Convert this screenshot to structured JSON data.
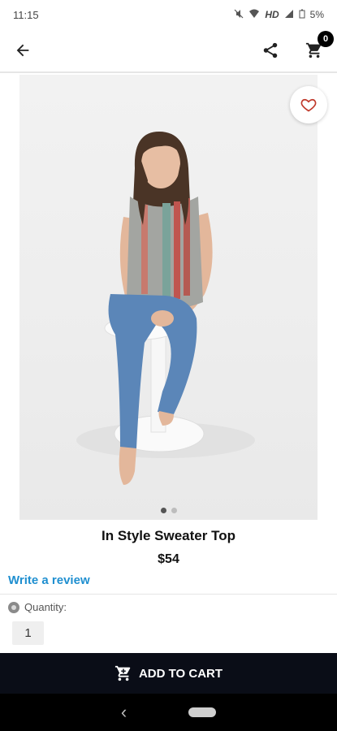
{
  "status_bar": {
    "time": "11:15",
    "network": "HD",
    "battery": "5%"
  },
  "app_bar": {
    "cart_count": "0"
  },
  "product": {
    "title": "In Style Sweater Top",
    "price": "$54",
    "image_count": 2,
    "active_image_index": 0
  },
  "review": {
    "link_label": "Write a review"
  },
  "quantity": {
    "label": "Quantity:",
    "value": "1"
  },
  "cta": {
    "label": "ADD TO CART"
  },
  "colors": {
    "link_blue": "#1f8fd0",
    "cart_button_bg": "#0a0d17",
    "heart_red": "#c0392b"
  }
}
